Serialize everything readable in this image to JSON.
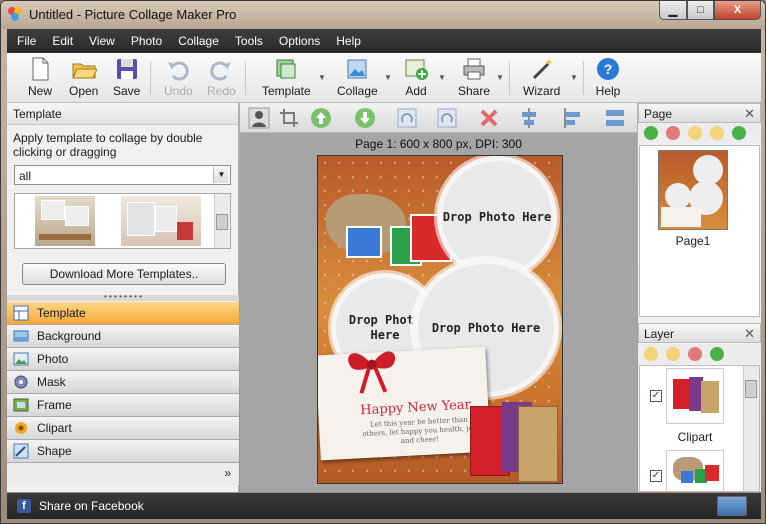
{
  "window": {
    "title": "Untitled - Picture Collage Maker Pro",
    "min_label": "▁",
    "max_label": "□",
    "close_label": "X"
  },
  "menu": [
    "File",
    "Edit",
    "View",
    "Photo",
    "Collage",
    "Tools",
    "Options",
    "Help"
  ],
  "toolbar": {
    "new": "New",
    "open": "Open",
    "save": "Save",
    "undo": "Undo",
    "redo": "Redo",
    "template": "Template",
    "collage": "Collage",
    "add": "Add",
    "share": "Share",
    "wizard": "Wizard",
    "help": "Help"
  },
  "left": {
    "header": "Template",
    "instruction": "Apply template to collage by double clicking or dragging",
    "filter_value": "all",
    "download_button": "Download More Templates..",
    "nav": [
      "Template",
      "Background",
      "Photo",
      "Mask",
      "Frame",
      "Clipart",
      "Shape"
    ],
    "active_nav": "Template",
    "more": "»"
  },
  "canvas": {
    "page_info": "Page 1: 600 x 800 px, DPI: 300",
    "drop1": "Drop Photo Here",
    "drop2": "Drop Photo Here",
    "drop3": "Drop Photo Here",
    "card_title": "Happy New Year",
    "card_message": "Let this year be better than others, let happy you health, joy and cheer!"
  },
  "page_panel": {
    "header": "Page",
    "close": "✕",
    "page_label": "Page1"
  },
  "layer_panel": {
    "header": "Layer",
    "close": "✕",
    "layer_label": "Clipart",
    "check": "✓"
  },
  "status": {
    "facebook": "Share on Facebook",
    "fb_glyph": "f"
  },
  "colors": {
    "accent": "#f4a636",
    "menubar": "#2e2e2e",
    "canvas_bg": "#c9722e"
  }
}
